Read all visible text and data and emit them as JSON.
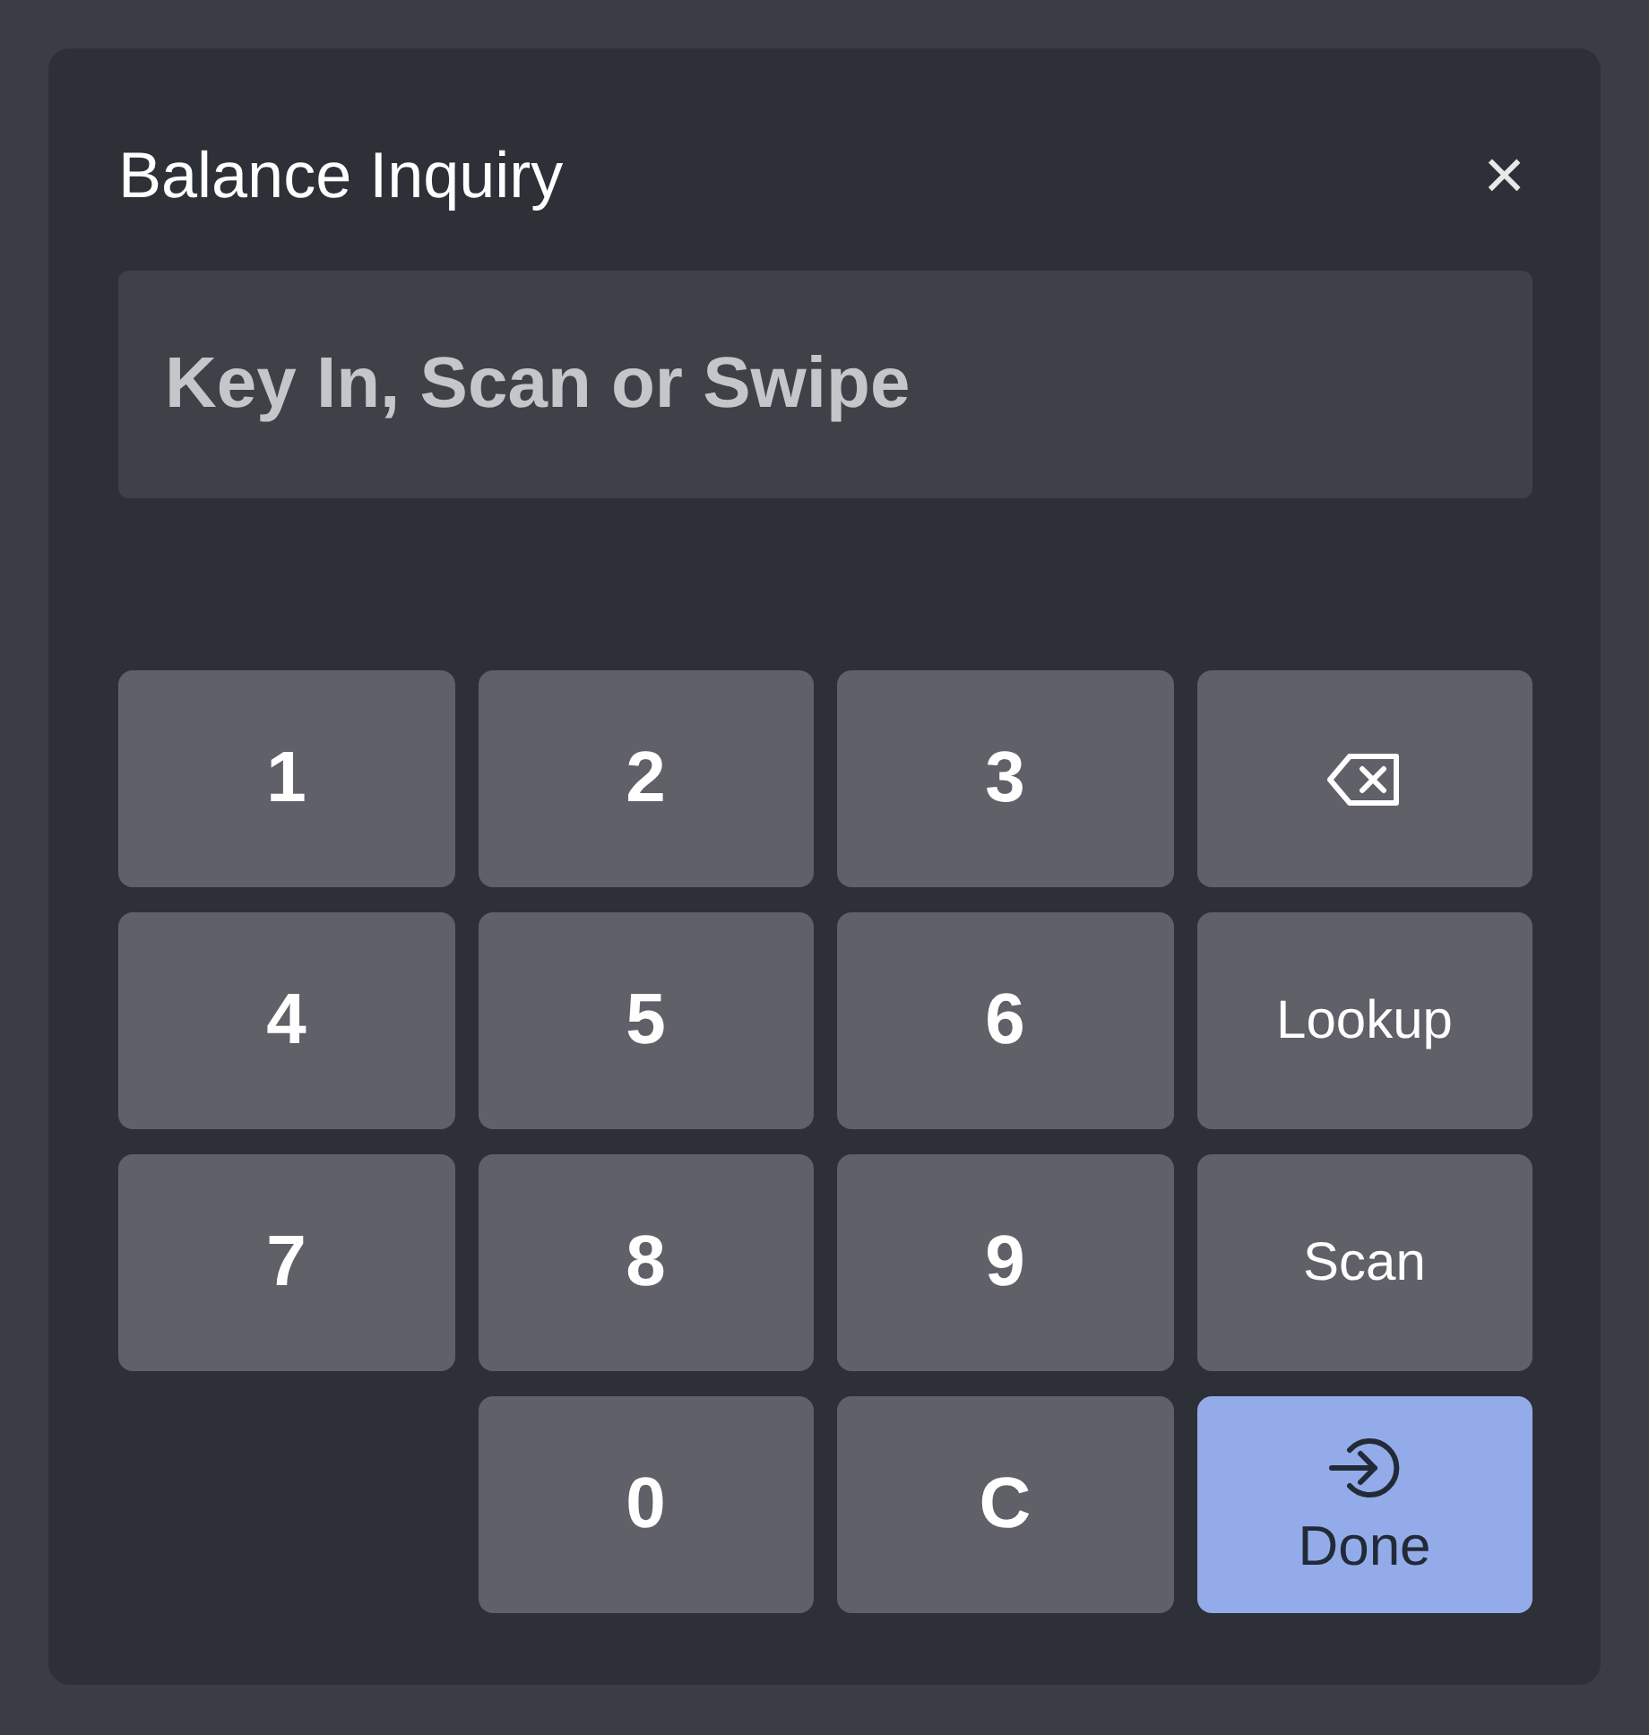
{
  "dialog": {
    "title": "Balance Inquiry",
    "close": "×"
  },
  "input": {
    "placeholder": "Key In, Scan or Swipe"
  },
  "keys": [
    {
      "kind": "digit",
      "label": "1"
    },
    {
      "kind": "digit",
      "label": "2"
    },
    {
      "kind": "digit",
      "label": "3"
    },
    {
      "kind": "backspace"
    },
    {
      "kind": "digit",
      "label": "4"
    },
    {
      "kind": "digit",
      "label": "5"
    },
    {
      "kind": "digit",
      "label": "6"
    },
    {
      "kind": "word",
      "label": "Lookup"
    },
    {
      "kind": "digit",
      "label": "7"
    },
    {
      "kind": "digit",
      "label": "8"
    },
    {
      "kind": "digit",
      "label": "9"
    },
    {
      "kind": "word",
      "label": "Scan"
    },
    {
      "kind": "digit",
      "label": "0"
    },
    {
      "kind": "digit",
      "label": "C"
    },
    {
      "kind": "done",
      "label": "Done"
    }
  ]
}
